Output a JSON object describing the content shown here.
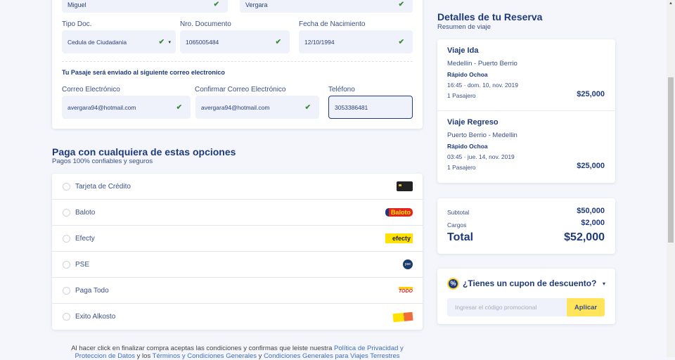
{
  "form": {
    "first_name": "Miguel",
    "last_name": "Vergara",
    "doc_type_label": "Tipo Doc.",
    "doc_type_value": "Cedula de Ciudadania",
    "doc_number_label": "Nro. Documento",
    "doc_number_value": "1065005484",
    "birth_label": "Fecha de Nacimiento",
    "birth_value": "12/10/1994",
    "email_notice": "Tu Pasaje será enviado al siguiente correo electronico",
    "email_label": "Correo Electrónico",
    "email_value": "avergara94@hotmail.com",
    "confirm_label": "Confirmar Correo Electrónico",
    "confirm_value": "avergara94@hotmail.com",
    "phone_label": "Teléfono",
    "phone_value": "3053386481"
  },
  "payment": {
    "title": "Paga con cualquiera de estas opciones",
    "subtitle": "Pagos 100% confiables y seguros",
    "options": [
      {
        "label": "Tarjeta de Crédito",
        "icon": "credit-card-icon"
      },
      {
        "label": "Baloto",
        "icon": "baloto-logo"
      },
      {
        "label": "Efecty",
        "icon": "efecty-logo"
      },
      {
        "label": "PSE",
        "icon": "pse-logo"
      },
      {
        "label": "Paga Todo",
        "icon": "pagatodo-logo"
      },
      {
        "label": "Exito Alkosto",
        "icon": "exito-alkosto-logo"
      }
    ],
    "logo_text": {
      "baloto": "Baloto",
      "efecty": "efecty",
      "pse": "pse",
      "pagatodo": "TODO"
    }
  },
  "footer": {
    "t1": "Al hacer click en finalizar compra aceptas las condiciones y confirmas que leiste nuestra ",
    "link1": "Política de Privacidad y Proteccion de Datos",
    "t2": " y los ",
    "link2": "Términos y Condiciones Generales",
    "t3": " y ",
    "link3": "Condiciones Generales para Viajes Terrestres"
  },
  "summary": {
    "title": "Detalles de tu Reserva",
    "subtitle": "Resumen de viaje",
    "trips": [
      {
        "title": "Viaje Ida",
        "route": "Medellin - Puerto Berrio",
        "company": "Rápido Ochoa",
        "datetime": "16:45 · dom. 10, nov. 2019",
        "passengers": "1 Pasajero",
        "price": "$25,000"
      },
      {
        "title": "Viaje Regreso",
        "route": "Puerto Berrio - Medellin",
        "company": "Rápido Ochoa",
        "datetime": "03:45 · jue. 14, nov. 2019",
        "passengers": "1 Pasajero",
        "price": "$25,000"
      }
    ],
    "subtotal_label": "Subtotal",
    "subtotal": "$50,000",
    "charges_label": "Cargos",
    "charges": "$2,000",
    "total_label": "Total",
    "total": "$52,000"
  },
  "coupon": {
    "title": "¿Tienes un cupon de descuento?",
    "placeholder": "Ingresar el código promocional",
    "button": "Aplicar",
    "icon_text": "%"
  },
  "colors": {
    "navy": "#1f3a7a",
    "yellow": "#ffe45c",
    "bg": "#f5f6fb"
  }
}
